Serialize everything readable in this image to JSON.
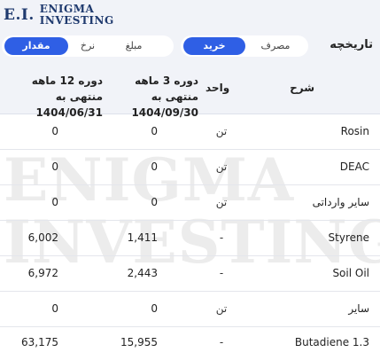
{
  "brand": {
    "mark": "E.I.",
    "line1": "ENIGMA",
    "line2": "INVESTING"
  },
  "page_title": "تاریخچه",
  "toggle_primary": {
    "options": [
      "خرید",
      "مصرف"
    ],
    "active": "خرید"
  },
  "toggle_secondary": {
    "options": [
      "مقدار",
      "نرخ",
      "مبلغ"
    ],
    "active": "مقدار"
  },
  "table": {
    "headers": {
      "desc": "شرح",
      "unit": "واحد",
      "period3": [
        "دوره 3 ماهه منتهی به",
        "1404/09/30"
      ],
      "period12": [
        "دوره 12 ماهه منتهی به",
        "1404/06/31"
      ]
    },
    "rows": [
      {
        "desc": "Rosin",
        "unit": "تن",
        "v3": "0",
        "v12": "0"
      },
      {
        "desc": "DEAC",
        "unit": "تن",
        "v3": "0",
        "v12": "0"
      },
      {
        "desc": "سایر وارداتی",
        "unit": "تن",
        "v3": "0",
        "v12": "0"
      },
      {
        "desc": "Styrene",
        "unit": "-",
        "v3": "1,411",
        "v12": "6,002"
      },
      {
        "desc": "Soil Oil",
        "unit": "-",
        "v3": "2,443",
        "v12": "6,972"
      },
      {
        "desc": "سایر",
        "unit": "تن",
        "v3": "0",
        "v12": "0"
      },
      {
        "desc": "Butadiene 1.3",
        "unit": "-",
        "v3": "15,955",
        "v12": "63,175"
      }
    ]
  },
  "watermark": {
    "line1": "ENIGMA",
    "line2": "INVESTING"
  },
  "colors": {
    "accent": "#2f5fe5",
    "header_bg": "#f1f3f8",
    "brand": "#1f3a6e"
  }
}
